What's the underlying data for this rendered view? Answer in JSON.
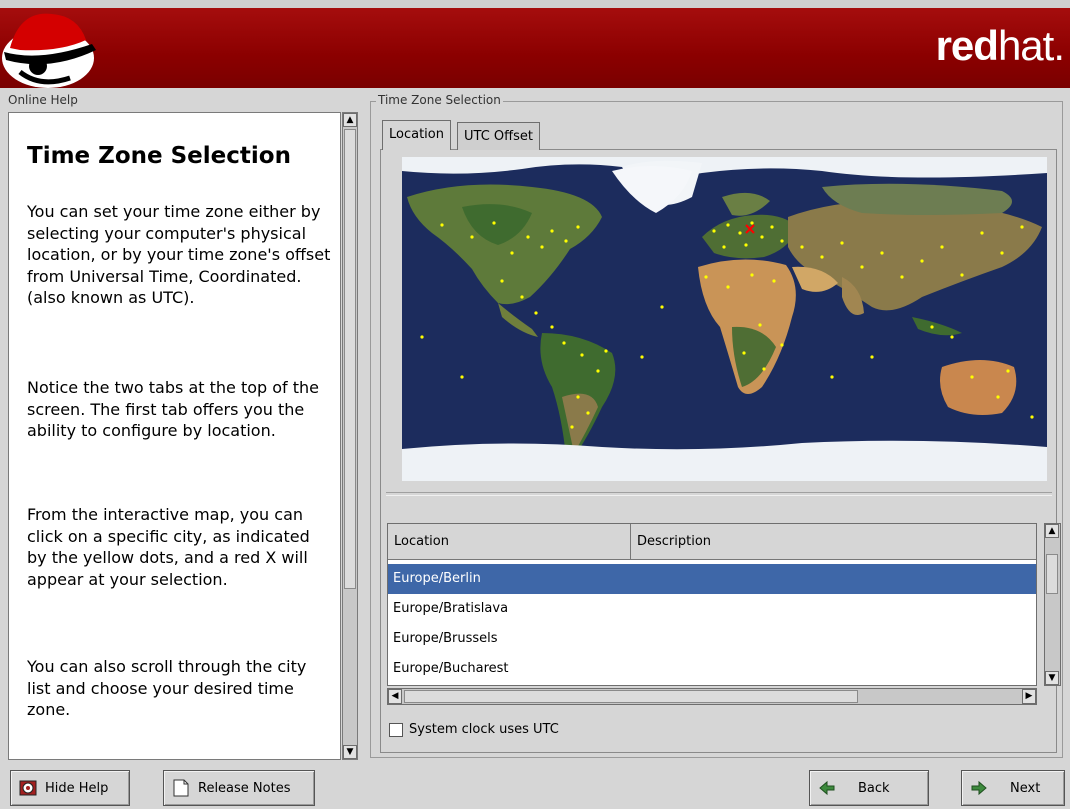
{
  "header": {
    "brand_bold": "red",
    "brand_light": "hat."
  },
  "help": {
    "section_label": "Online Help",
    "title": "Time Zone Selection",
    "paragraphs": [
      "You can set your time zone either by selecting your computer's physical location, or by your time zone's offset from Universal Time, Coordinated. (also known as UTC).",
      "Notice the two tabs at the top of the screen. The first tab offers you the ability to configure by location.",
      "From the interactive map, you can click on a specific city, as indicated by the yellow dots, and a red X will appear at your selection.",
      "You can also scroll through the city list and choose your desired time zone."
    ]
  },
  "timezone": {
    "section_label": "Time Zone Selection",
    "tabs": [
      {
        "label": "Location",
        "active": true
      },
      {
        "label": "UTC Offset",
        "active": false
      }
    ],
    "table": {
      "columns": [
        "Location",
        "Description"
      ],
      "rows": [
        {
          "location": "Europe/Berlin",
          "description": "",
          "selected": true
        },
        {
          "location": "Europe/Bratislava",
          "description": "",
          "selected": false
        },
        {
          "location": "Europe/Brussels",
          "description": "",
          "selected": false
        },
        {
          "location": "Europe/Bucharest",
          "description": "",
          "selected": false
        }
      ]
    },
    "utc_checkbox": {
      "label": "System clock uses UTC",
      "checked": false
    }
  },
  "buttons": {
    "hide_help": "Hide Help",
    "release_notes": "Release Notes",
    "back": "Back",
    "next": "Next"
  },
  "colors": {
    "banner": "#8b0000",
    "selection": "#3e67a8",
    "city_dot": "#ffff00",
    "selected_city": "#ff0000",
    "ocean": "#1c2c5d"
  },
  "icons": {
    "logo": "shadowman-hat-logo",
    "hide_help": "help-book-icon",
    "release_notes": "document-icon",
    "back": "back-arrow-icon",
    "next": "next-arrow-icon"
  }
}
